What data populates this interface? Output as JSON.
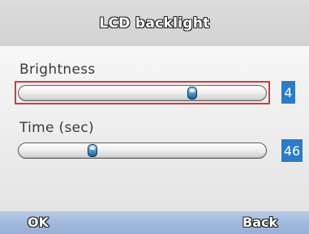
{
  "title": "LCD backlight",
  "settings": [
    {
      "label": "Brightness",
      "value": "4",
      "level": 0.72,
      "focused": true
    },
    {
      "label": "Time (sec)",
      "value": "46",
      "level": 0.28,
      "focused": false
    }
  ],
  "softkeys": {
    "left": "OK",
    "right": "Back"
  },
  "colors": {
    "focus": "#d23a3a",
    "value_badge": "#2d7bc6",
    "thumb": "#3a86c0",
    "softkey_bar": "#a2b9dc"
  },
  "icons": {
    "slider_thumb": "slider-thumb-icon"
  }
}
